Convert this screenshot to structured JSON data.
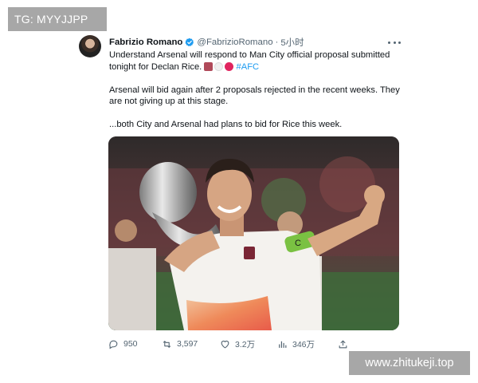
{
  "watermarks": {
    "top_left": "TG: MYYJJPP",
    "bottom_right": "www.zhitukeji.top"
  },
  "tweet": {
    "author": {
      "name": "Fabrizio Romano",
      "handle": "@FabrizioRomano",
      "verified": true
    },
    "separator": "·",
    "time": "5小时",
    "body": {
      "paragraph_1": "Understand Arsenal will respond to Man City official proposal submitted tonight for Declan Rice.",
      "hashtag": "#AFC",
      "paragraph_2": "Arsenal will bid again after 2 proposals rejected in the recent weeks. They are not giving up at this stage.",
      "paragraph_3": "...both City and Arsenal had plans to bid for Rice this week."
    },
    "emojis": [
      "hammer-emoji",
      "white-circle-emoji",
      "red-circle-emoji"
    ],
    "media": {
      "icon": "photo",
      "armband_text": "C"
    },
    "actions": {
      "replies": "950",
      "retweets": "3,597",
      "likes": "3.2万",
      "views": "346万"
    }
  },
  "colors": {
    "link": "#1d9bf0",
    "secondary_text": "#536471",
    "primary_text": "#0f1419",
    "watermark_bg": "#a7a7a7",
    "verified": "#1d9bf0"
  }
}
